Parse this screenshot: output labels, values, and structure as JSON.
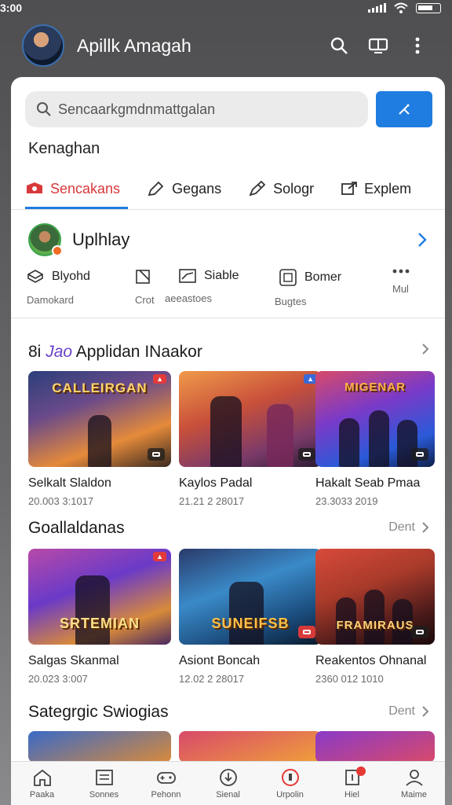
{
  "status": {
    "time": "3:00"
  },
  "app": {
    "title": "Apillk Amagah"
  },
  "search": {
    "placeholder": "Sencaarkgmdnmattgalan"
  },
  "section_head": "Kenaghan",
  "tabs": [
    {
      "label": "Sencakans",
      "icon": "tag-icon",
      "active": true
    },
    {
      "label": "Gegans",
      "icon": "pencil-icon",
      "active": false
    },
    {
      "label": "Sologr",
      "icon": "pen-icon",
      "active": false
    },
    {
      "label": "Explem",
      "icon": "external-icon",
      "active": false
    }
  ],
  "profile": {
    "name": "Uplhlay"
  },
  "quick": [
    {
      "label": "Blyohd",
      "sub": "Damokard",
      "icon": "cube-icon"
    },
    {
      "label": "",
      "sub": "Crot",
      "icon": "crop-icon"
    },
    {
      "label": "Siable",
      "sub": "aeeastoes",
      "icon": "chart-icon"
    },
    {
      "label": "Bomer",
      "sub": "Bugtes",
      "icon": "grid-icon"
    },
    {
      "label": "",
      "sub": "Mul",
      "icon": "more-icon"
    }
  ],
  "sections": [
    {
      "title_prefix": "8i",
      "title_accent": "Jao",
      "title_rest": "Applidan INaakor",
      "more": "",
      "items": [
        {
          "name": "Selkalt Slaldon",
          "date": "20.003 3:1017",
          "art": "CALLEIRGAN"
        },
        {
          "name": "Kaylos Padal",
          "date": "21.21 2 28017",
          "art": ""
        },
        {
          "name": "Hakalt Seab Pmaa",
          "date": "23.3033 2019",
          "art": "MIGENAR"
        }
      ]
    },
    {
      "title": "Goallaldanas",
      "more": "Dent",
      "items": [
        {
          "name": "Salgas Skanmal",
          "date": "20.023 3:007",
          "art": "SRTEMIAN"
        },
        {
          "name": "Asiont Boncah",
          "date": "12.02 2 28017",
          "art": "SUNEIFSB"
        },
        {
          "name": "Reakentos Ohnanal",
          "date": "2360 012 1010",
          "art": "FRAMIRAUS"
        }
      ]
    },
    {
      "title": "Sategrgic Swiogias",
      "more": "Dent"
    }
  ],
  "nav": [
    {
      "label": "Paaka",
      "icon": "home-icon"
    },
    {
      "label": "Sonnes",
      "icon": "list-icon"
    },
    {
      "label": "Pehonn",
      "icon": "gamepad-icon"
    },
    {
      "label": "Sienal",
      "icon": "download-icon"
    },
    {
      "label": "Urpolin",
      "icon": "shield-icon"
    },
    {
      "label": "Hiel",
      "icon": "notification-icon"
    },
    {
      "label": "Maime",
      "icon": "person-icon"
    }
  ],
  "colors": {
    "accent": "#1f7ce0",
    "active_tab": "#d8383a"
  }
}
